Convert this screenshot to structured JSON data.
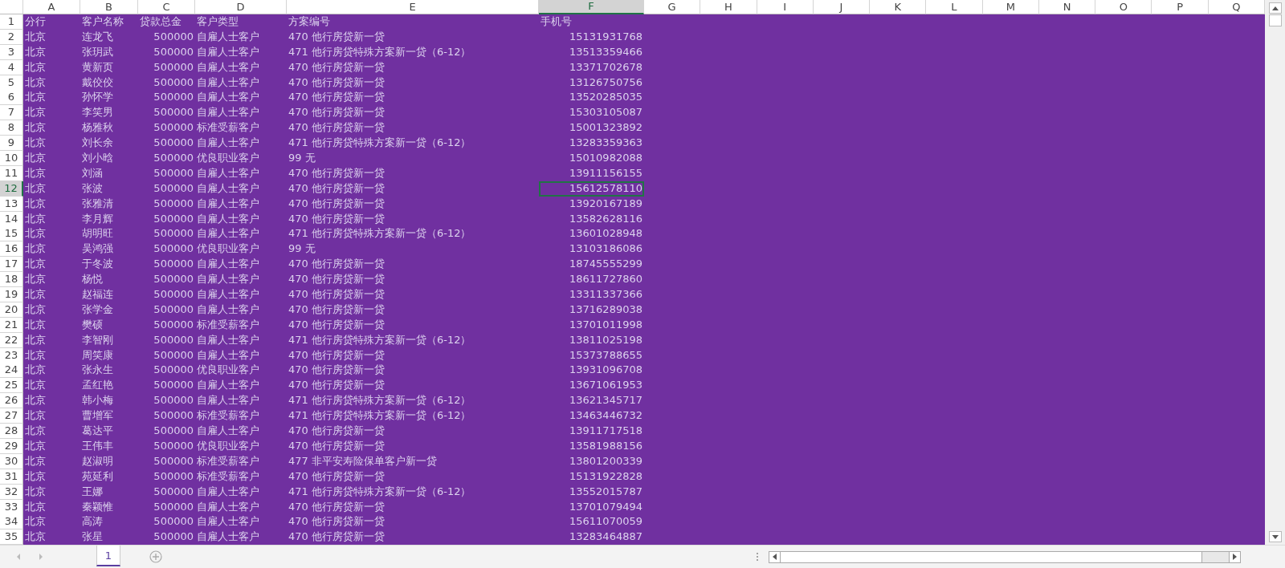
{
  "columns": [
    {
      "letter": "A",
      "selected": false,
      "numeric": false
    },
    {
      "letter": "B",
      "selected": false,
      "numeric": false
    },
    {
      "letter": "C",
      "selected": false,
      "numeric": true
    },
    {
      "letter": "D",
      "selected": false,
      "numeric": false
    },
    {
      "letter": "E",
      "selected": false,
      "numeric": false
    },
    {
      "letter": "F",
      "selected": true,
      "numeric": true
    },
    {
      "letter": "G",
      "selected": false
    },
    {
      "letter": "H",
      "selected": false
    },
    {
      "letter": "I",
      "selected": false
    },
    {
      "letter": "J",
      "selected": false
    },
    {
      "letter": "K",
      "selected": false
    },
    {
      "letter": "L",
      "selected": false
    },
    {
      "letter": "M",
      "selected": false
    },
    {
      "letter": "N",
      "selected": false
    },
    {
      "letter": "O",
      "selected": false
    },
    {
      "letter": "P",
      "selected": false
    },
    {
      "letter": "Q",
      "selected": false
    }
  ],
  "rows": [
    {
      "n": "1",
      "kind": "header",
      "selected": false,
      "cells": [
        "分行",
        "客户名称",
        "贷款总金",
        "客户类型",
        "方案编号",
        "手机号"
      ]
    },
    {
      "n": "2",
      "kind": "data",
      "selected": false,
      "cells": [
        "北京",
        "连龙飞",
        "500000",
        "自雇人士客户",
        "470 他行房贷新一贷",
        "15131931768"
      ]
    },
    {
      "n": "3",
      "kind": "data",
      "selected": false,
      "cells": [
        "北京",
        "张玥武",
        "500000",
        "自雇人士客户",
        "471 他行房贷特殊方案新一贷（6-12）",
        "13513359466"
      ]
    },
    {
      "n": "4",
      "kind": "data",
      "selected": false,
      "cells": [
        "北京",
        "黄新页",
        "500000",
        "自雇人士客户",
        "470 他行房贷新一贷",
        "13371702678"
      ]
    },
    {
      "n": "5",
      "kind": "data",
      "selected": false,
      "cells": [
        "北京",
        "戴佼佼",
        "500000",
        "自雇人士客户",
        "470 他行房贷新一贷",
        "13126750756"
      ]
    },
    {
      "n": "6",
      "kind": "data",
      "selected": false,
      "cells": [
        "北京",
        "孙怀学",
        "500000",
        "自雇人士客户",
        "470 他行房贷新一贷",
        "13520285035"
      ]
    },
    {
      "n": "7",
      "kind": "data",
      "selected": false,
      "cells": [
        "北京",
        "李笑男",
        "500000",
        "自雇人士客户",
        "470 他行房贷新一贷",
        "15303105087"
      ]
    },
    {
      "n": "8",
      "kind": "data",
      "selected": false,
      "cells": [
        "北京",
        "杨雅秋",
        "500000",
        "标准受薪客户",
        "470 他行房贷新一贷",
        "15001323892"
      ]
    },
    {
      "n": "9",
      "kind": "data",
      "selected": false,
      "cells": [
        "北京",
        "刘长余",
        "500000",
        "自雇人士客户",
        "471 他行房贷特殊方案新一贷（6-12）",
        "13283359363"
      ]
    },
    {
      "n": "10",
      "kind": "data",
      "selected": false,
      "cells": [
        "北京",
        "刘小晗",
        "500000",
        "优良职业客户",
        "99 无",
        "15010982088"
      ]
    },
    {
      "n": "11",
      "kind": "data",
      "selected": false,
      "cells": [
        "北京",
        "刘涵",
        "500000",
        "自雇人士客户",
        "470 他行房贷新一贷",
        "13911156155"
      ]
    },
    {
      "n": "12",
      "kind": "data",
      "selected": true,
      "cells": [
        "北京",
        "张波",
        "500000",
        "自雇人士客户",
        "470 他行房贷新一贷",
        "15612578110"
      ]
    },
    {
      "n": "13",
      "kind": "data",
      "selected": false,
      "cells": [
        "北京",
        "张雅清",
        "500000",
        "自雇人士客户",
        "470 他行房贷新一贷",
        "13920167189"
      ]
    },
    {
      "n": "14",
      "kind": "data",
      "selected": false,
      "cells": [
        "北京",
        "李月辉",
        "500000",
        "自雇人士客户",
        "470 他行房贷新一贷",
        "13582628116"
      ]
    },
    {
      "n": "15",
      "kind": "data",
      "selected": false,
      "cells": [
        "北京",
        "胡明旺",
        "500000",
        "自雇人士客户",
        "471 他行房贷特殊方案新一贷（6-12）",
        "13601028948"
      ]
    },
    {
      "n": "16",
      "kind": "data",
      "selected": false,
      "cells": [
        "北京",
        "吴鸿强",
        "500000",
        "优良职业客户",
        "99 无",
        "13103186086"
      ]
    },
    {
      "n": "17",
      "kind": "data",
      "selected": false,
      "cells": [
        "北京",
        "于冬波",
        "500000",
        "自雇人士客户",
        "470 他行房贷新一贷",
        "18745555299"
      ]
    },
    {
      "n": "18",
      "kind": "data",
      "selected": false,
      "cells": [
        "北京",
        "杨悦",
        "500000",
        "自雇人士客户",
        "470 他行房贷新一贷",
        "18611727860"
      ]
    },
    {
      "n": "19",
      "kind": "data",
      "selected": false,
      "cells": [
        "北京",
        "赵福连",
        "500000",
        "自雇人士客户",
        "470 他行房贷新一贷",
        "13311337366"
      ]
    },
    {
      "n": "20",
      "kind": "data",
      "selected": false,
      "cells": [
        "北京",
        "张学金",
        "500000",
        "自雇人士客户",
        "470 他行房贷新一贷",
        "13716289038"
      ]
    },
    {
      "n": "21",
      "kind": "data",
      "selected": false,
      "cells": [
        "北京",
        "樊硕",
        "500000",
        "标准受薪客户",
        "470 他行房贷新一贷",
        "13701011998"
      ]
    },
    {
      "n": "22",
      "kind": "data",
      "selected": false,
      "cells": [
        "北京",
        "李智刚",
        "500000",
        "自雇人士客户",
        "471 他行房贷特殊方案新一贷（6-12）",
        "13811025198"
      ]
    },
    {
      "n": "23",
      "kind": "data",
      "selected": false,
      "cells": [
        "北京",
        "周笑康",
        "500000",
        "自雇人士客户",
        "470 他行房贷新一贷",
        "15373788655"
      ]
    },
    {
      "n": "24",
      "kind": "data",
      "selected": false,
      "cells": [
        "北京",
        "张永生",
        "500000",
        "优良职业客户",
        "470 他行房贷新一贷",
        "13931096708"
      ]
    },
    {
      "n": "25",
      "kind": "data",
      "selected": false,
      "cells": [
        "北京",
        "孟红艳",
        "500000",
        "自雇人士客户",
        "470 他行房贷新一贷",
        "13671061953"
      ]
    },
    {
      "n": "26",
      "kind": "data",
      "selected": false,
      "cells": [
        "北京",
        "韩小梅",
        "500000",
        "自雇人士客户",
        "471 他行房贷特殊方案新一贷（6-12）",
        "13621345717"
      ]
    },
    {
      "n": "27",
      "kind": "data",
      "selected": false,
      "cells": [
        "北京",
        "曹增军",
        "500000",
        "标准受薪客户",
        "471 他行房贷特殊方案新一贷（6-12）",
        "13463446732"
      ]
    },
    {
      "n": "28",
      "kind": "data",
      "selected": false,
      "cells": [
        "北京",
        "葛达平",
        "500000",
        "自雇人士客户",
        "470 他行房贷新一贷",
        "13911717518"
      ]
    },
    {
      "n": "29",
      "kind": "data",
      "selected": false,
      "cells": [
        "北京",
        "王伟丰",
        "500000",
        "优良职业客户",
        "470 他行房贷新一贷",
        "13581988156"
      ]
    },
    {
      "n": "30",
      "kind": "data",
      "selected": false,
      "cells": [
        "北京",
        "赵淑明",
        "500000",
        "标准受薪客户",
        "477 非平安寿险保单客户新一贷",
        "13801200339"
      ]
    },
    {
      "n": "31",
      "kind": "data",
      "selected": false,
      "cells": [
        "北京",
        "苑延利",
        "500000",
        "标准受薪客户",
        "470 他行房贷新一贷",
        "15131922828"
      ]
    },
    {
      "n": "32",
      "kind": "data",
      "selected": false,
      "cells": [
        "北京",
        "王娜",
        "500000",
        "自雇人士客户",
        "471 他行房贷特殊方案新一贷（6-12）",
        "13552015787"
      ]
    },
    {
      "n": "33",
      "kind": "data",
      "selected": false,
      "cells": [
        "北京",
        "秦颖惟",
        "500000",
        "自雇人士客户",
        "470 他行房贷新一贷",
        "13701079494"
      ]
    },
    {
      "n": "34",
      "kind": "data",
      "selected": false,
      "cells": [
        "北京",
        "高涛",
        "500000",
        "自雇人士客户",
        "470 他行房贷新一贷",
        "15611070059"
      ]
    },
    {
      "n": "35",
      "kind": "data",
      "selected": false,
      "cells": [
        "北京",
        "张星",
        "500000",
        "自雇人士客户",
        "470 他行房贷新一贷",
        "13283464887"
      ]
    }
  ],
  "sheets": [
    {
      "label": "1",
      "selected": true
    }
  ]
}
